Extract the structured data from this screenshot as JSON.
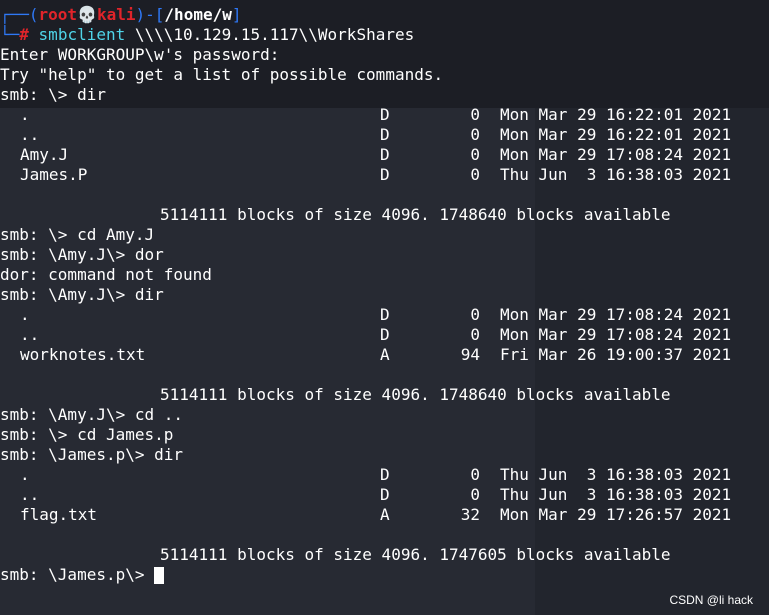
{
  "prompt": {
    "user": "root",
    "skull": "💀",
    "host": "kali",
    "path": "/home/w",
    "hash": "#",
    "command": "smbclient",
    "args": " \\\\\\\\10.129.15.117\\\\WorkShares"
  },
  "lines": {
    "password": "Enter WORKGROUP\\w's password:",
    "help": "Try \"help\" to get a list of possible commands.",
    "cmd1": "smb: \\> dir",
    "blocks1": "5114111 blocks of size 4096. 1748640 blocks available",
    "cmd2": "smb: \\> cd Amy.J",
    "cmd3": "smb: \\Amy.J\\> dor",
    "error": "dor: command not found",
    "cmd4": "smb: \\Amy.J\\> dir",
    "blocks2": "5114111 blocks of size 4096. 1748640 blocks available",
    "cmd5": "smb: \\Amy.J\\> cd ..",
    "cmd6": "smb: \\> cd James.p",
    "cmd7": "smb: \\James.p\\> dir",
    "blocks3": "5114111 blocks of size 4096. 1747605 blocks available",
    "final_prompt": "smb: \\James.p\\> "
  },
  "listings": [
    [
      {
        "name": ".",
        "attr": "D",
        "size": "0",
        "date": "Mon Mar 29 16:22:01 2021"
      },
      {
        "name": "..",
        "attr": "D",
        "size": "0",
        "date": "Mon Mar 29 16:22:01 2021"
      },
      {
        "name": "Amy.J",
        "attr": "D",
        "size": "0",
        "date": "Mon Mar 29 17:08:24 2021"
      },
      {
        "name": "James.P",
        "attr": "D",
        "size": "0",
        "date": "Thu Jun  3 16:38:03 2021"
      }
    ],
    [
      {
        "name": ".",
        "attr": "D",
        "size": "0",
        "date": "Mon Mar 29 17:08:24 2021"
      },
      {
        "name": "..",
        "attr": "D",
        "size": "0",
        "date": "Mon Mar 29 17:08:24 2021"
      },
      {
        "name": "worknotes.txt",
        "attr": "A",
        "size": "94",
        "date": "Fri Mar 26 19:00:37 2021"
      }
    ],
    [
      {
        "name": ".",
        "attr": "D",
        "size": "0",
        "date": "Thu Jun  3 16:38:03 2021"
      },
      {
        "name": "..",
        "attr": "D",
        "size": "0",
        "date": "Thu Jun  3 16:38:03 2021"
      },
      {
        "name": "flag.txt",
        "attr": "A",
        "size": "32",
        "date": "Mon Mar 29 17:26:57 2021"
      }
    ]
  ],
  "watermark": "CSDN @li hack",
  "colors": {
    "background": "#1e2129",
    "prompt_blue": "#2f78f5",
    "prompt_red": "#e0242a",
    "command_cyan": "#4fd4e8"
  }
}
